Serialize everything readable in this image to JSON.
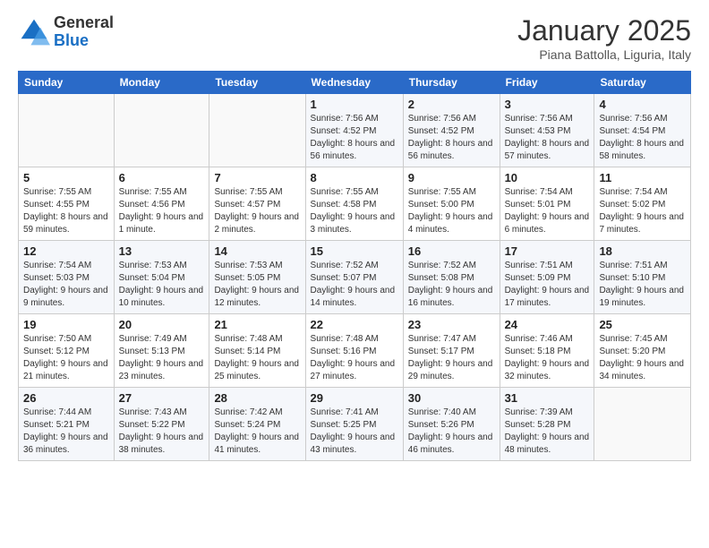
{
  "logo": {
    "general": "General",
    "blue": "Blue"
  },
  "title": "January 2025",
  "subtitle": "Piana Battolla, Liguria, Italy",
  "weekdays": [
    "Sunday",
    "Monday",
    "Tuesday",
    "Wednesday",
    "Thursday",
    "Friday",
    "Saturday"
  ],
  "weeks": [
    [
      {
        "day": "",
        "info": ""
      },
      {
        "day": "",
        "info": ""
      },
      {
        "day": "",
        "info": ""
      },
      {
        "day": "1",
        "info": "Sunrise: 7:56 AM\nSunset: 4:52 PM\nDaylight: 8 hours and 56 minutes."
      },
      {
        "day": "2",
        "info": "Sunrise: 7:56 AM\nSunset: 4:52 PM\nDaylight: 8 hours and 56 minutes."
      },
      {
        "day": "3",
        "info": "Sunrise: 7:56 AM\nSunset: 4:53 PM\nDaylight: 8 hours and 57 minutes."
      },
      {
        "day": "4",
        "info": "Sunrise: 7:56 AM\nSunset: 4:54 PM\nDaylight: 8 hours and 58 minutes."
      }
    ],
    [
      {
        "day": "5",
        "info": "Sunrise: 7:55 AM\nSunset: 4:55 PM\nDaylight: 8 hours and 59 minutes."
      },
      {
        "day": "6",
        "info": "Sunrise: 7:55 AM\nSunset: 4:56 PM\nDaylight: 9 hours and 1 minute."
      },
      {
        "day": "7",
        "info": "Sunrise: 7:55 AM\nSunset: 4:57 PM\nDaylight: 9 hours and 2 minutes."
      },
      {
        "day": "8",
        "info": "Sunrise: 7:55 AM\nSunset: 4:58 PM\nDaylight: 9 hours and 3 minutes."
      },
      {
        "day": "9",
        "info": "Sunrise: 7:55 AM\nSunset: 5:00 PM\nDaylight: 9 hours and 4 minutes."
      },
      {
        "day": "10",
        "info": "Sunrise: 7:54 AM\nSunset: 5:01 PM\nDaylight: 9 hours and 6 minutes."
      },
      {
        "day": "11",
        "info": "Sunrise: 7:54 AM\nSunset: 5:02 PM\nDaylight: 9 hours and 7 minutes."
      }
    ],
    [
      {
        "day": "12",
        "info": "Sunrise: 7:54 AM\nSunset: 5:03 PM\nDaylight: 9 hours and 9 minutes."
      },
      {
        "day": "13",
        "info": "Sunrise: 7:53 AM\nSunset: 5:04 PM\nDaylight: 9 hours and 10 minutes."
      },
      {
        "day": "14",
        "info": "Sunrise: 7:53 AM\nSunset: 5:05 PM\nDaylight: 9 hours and 12 minutes."
      },
      {
        "day": "15",
        "info": "Sunrise: 7:52 AM\nSunset: 5:07 PM\nDaylight: 9 hours and 14 minutes."
      },
      {
        "day": "16",
        "info": "Sunrise: 7:52 AM\nSunset: 5:08 PM\nDaylight: 9 hours and 16 minutes."
      },
      {
        "day": "17",
        "info": "Sunrise: 7:51 AM\nSunset: 5:09 PM\nDaylight: 9 hours and 17 minutes."
      },
      {
        "day": "18",
        "info": "Sunrise: 7:51 AM\nSunset: 5:10 PM\nDaylight: 9 hours and 19 minutes."
      }
    ],
    [
      {
        "day": "19",
        "info": "Sunrise: 7:50 AM\nSunset: 5:12 PM\nDaylight: 9 hours and 21 minutes."
      },
      {
        "day": "20",
        "info": "Sunrise: 7:49 AM\nSunset: 5:13 PM\nDaylight: 9 hours and 23 minutes."
      },
      {
        "day": "21",
        "info": "Sunrise: 7:48 AM\nSunset: 5:14 PM\nDaylight: 9 hours and 25 minutes."
      },
      {
        "day": "22",
        "info": "Sunrise: 7:48 AM\nSunset: 5:16 PM\nDaylight: 9 hours and 27 minutes."
      },
      {
        "day": "23",
        "info": "Sunrise: 7:47 AM\nSunset: 5:17 PM\nDaylight: 9 hours and 29 minutes."
      },
      {
        "day": "24",
        "info": "Sunrise: 7:46 AM\nSunset: 5:18 PM\nDaylight: 9 hours and 32 minutes."
      },
      {
        "day": "25",
        "info": "Sunrise: 7:45 AM\nSunset: 5:20 PM\nDaylight: 9 hours and 34 minutes."
      }
    ],
    [
      {
        "day": "26",
        "info": "Sunrise: 7:44 AM\nSunset: 5:21 PM\nDaylight: 9 hours and 36 minutes."
      },
      {
        "day": "27",
        "info": "Sunrise: 7:43 AM\nSunset: 5:22 PM\nDaylight: 9 hours and 38 minutes."
      },
      {
        "day": "28",
        "info": "Sunrise: 7:42 AM\nSunset: 5:24 PM\nDaylight: 9 hours and 41 minutes."
      },
      {
        "day": "29",
        "info": "Sunrise: 7:41 AM\nSunset: 5:25 PM\nDaylight: 9 hours and 43 minutes."
      },
      {
        "day": "30",
        "info": "Sunrise: 7:40 AM\nSunset: 5:26 PM\nDaylight: 9 hours and 46 minutes."
      },
      {
        "day": "31",
        "info": "Sunrise: 7:39 AM\nSunset: 5:28 PM\nDaylight: 9 hours and 48 minutes."
      },
      {
        "day": "",
        "info": ""
      }
    ]
  ]
}
